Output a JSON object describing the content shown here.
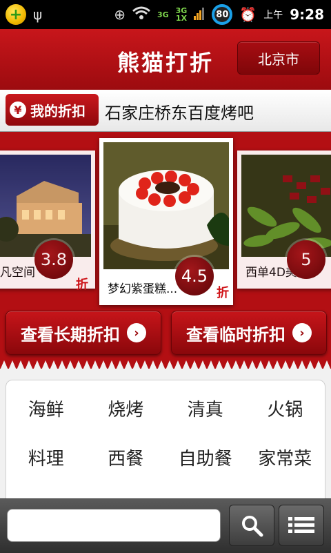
{
  "status_bar": {
    "net_top": "3G",
    "net_bottom": "1X",
    "net_left": "3G",
    "battery": "80",
    "ampm": "上午",
    "time": "9:28"
  },
  "header": {
    "title": "熊猫打折",
    "city": "北京市"
  },
  "ticker": {
    "my_discount_label": "我的折扣",
    "yen_symbol": "¥",
    "marquee_text": "石家庄桥东百度烤吧"
  },
  "carousel": {
    "zhe": "折",
    "cards": [
      {
        "caption": "凡空间",
        "rating": "3.8"
      },
      {
        "caption": "梦幻紫蛋糕...",
        "rating": "4.5"
      },
      {
        "caption": "西单4D美",
        "rating": "5"
      }
    ]
  },
  "actions": {
    "long_term": "查看长期折扣",
    "temporary": "查看临时折扣"
  },
  "categories": [
    "海鲜",
    "烧烤",
    "清真",
    "火锅",
    "料理",
    "西餐",
    "自助餐",
    "家常菜"
  ],
  "colors": {
    "brand_red": "#b30f13",
    "battery_ring": "#1aa0e8"
  }
}
